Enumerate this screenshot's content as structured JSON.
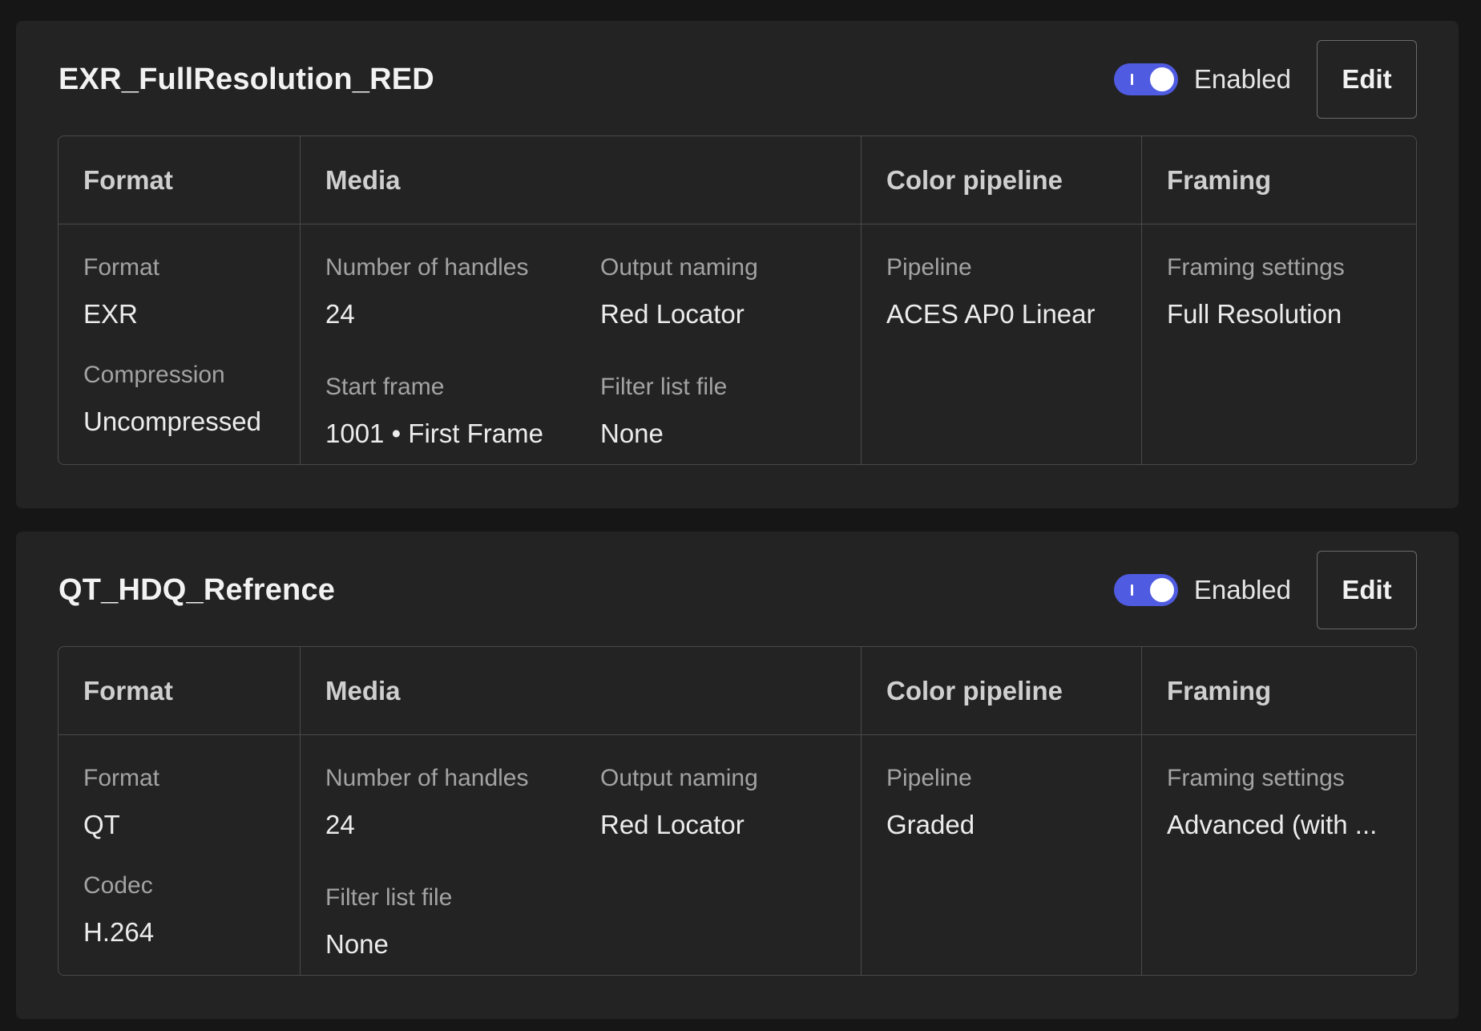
{
  "presets": [
    {
      "title": "EXR_FullResolution_RED",
      "toggle_label": "Enabled",
      "edit_label": "Edit",
      "headers": {
        "format": "Format",
        "media": "Media",
        "color": "Color pipeline",
        "framing": "Framing"
      },
      "format": {
        "format_label": "Format",
        "format_value": "EXR",
        "second_label": "Compression",
        "second_value": "Uncompressed"
      },
      "media": {
        "handles_label": "Number of handles",
        "handles_value": "24",
        "naming_label": "Output naming",
        "naming_value": "Red Locator",
        "third_label": "Start frame",
        "third_value": "1001 • First Frame",
        "fourth_label": "Filter list file",
        "fourth_value": "None"
      },
      "color": {
        "pipeline_label": "Pipeline",
        "pipeline_value": "ACES AP0 Linear"
      },
      "framing": {
        "settings_label": "Framing settings",
        "settings_value": "Full Resolution"
      }
    },
    {
      "title": "QT_HDQ_Refrence",
      "toggle_label": "Enabled",
      "edit_label": "Edit",
      "headers": {
        "format": "Format",
        "media": "Media",
        "color": "Color pipeline",
        "framing": "Framing"
      },
      "format": {
        "format_label": "Format",
        "format_value": "QT",
        "second_label": "Codec",
        "second_value": "H.264"
      },
      "media": {
        "handles_label": "Number of handles",
        "handles_value": "24",
        "naming_label": "Output naming",
        "naming_value": "Red Locator",
        "third_label": "Filter list file",
        "third_value": "None"
      },
      "color": {
        "pipeline_label": "Pipeline",
        "pipeline_value": "Graded"
      },
      "framing": {
        "settings_label": "Framing settings",
        "settings_value": "Advanced (with ..."
      }
    }
  ],
  "toggle_state": "on",
  "colors": {
    "accent": "#4f5be0",
    "background": "#161616",
    "card": "#232323"
  }
}
